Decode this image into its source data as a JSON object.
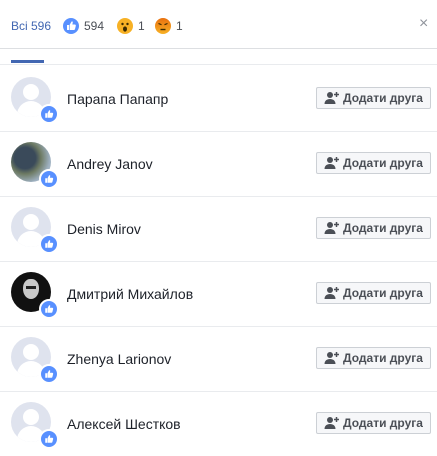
{
  "header": {
    "tabs": [
      {
        "label": "Всі 596"
      },
      {
        "label": "594"
      },
      {
        "label": "1"
      },
      {
        "label": "1"
      }
    ],
    "close_glyph": "×"
  },
  "colors": {
    "accent": "#4267b2",
    "like": "#5890ff",
    "wow": "#f7b125",
    "angry": "#e9710f"
  },
  "rows": [
    {
      "name": "Парапа Папапр",
      "button": "Додати друга",
      "avatar": "default"
    },
    {
      "name": "Andrey Janov",
      "button": "Додати друга",
      "avatar": "photo"
    },
    {
      "name": "Denis Mirov",
      "button": "Додати друга",
      "avatar": "default"
    },
    {
      "name": "Дмитрий Михайлов",
      "button": "Додати друга",
      "avatar": "photo"
    },
    {
      "name": "Zhenya Larionov",
      "button": "Додати друга",
      "avatar": "default"
    },
    {
      "name": "Алексей Шестков",
      "button": "Додати друга",
      "avatar": "default"
    }
  ]
}
